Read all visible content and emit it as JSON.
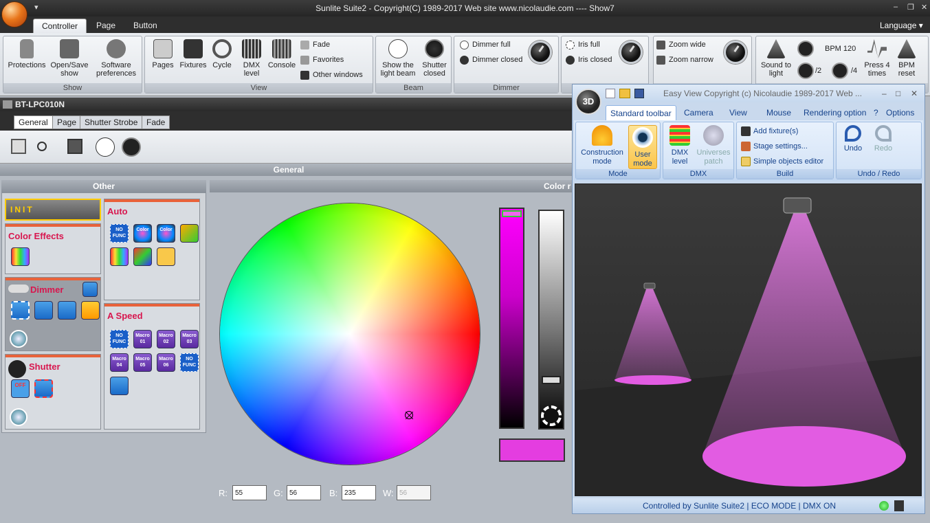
{
  "window": {
    "title": "Sunlite Suite2 - Copyright(C) 1989-2017    Web site www.nicolaudie.com ---- Show7",
    "lang_label": "Language"
  },
  "ribbon_tabs": [
    "Controller",
    "Page",
    "Button"
  ],
  "groups": {
    "show": {
      "label": "Show",
      "protections": "Protections",
      "open_save": "Open/Save show",
      "software_prefs": "Software preferences"
    },
    "view": {
      "label": "View",
      "pages": "Pages",
      "fixtures": "Fixtures",
      "cycle": "Cycle",
      "dmx_level": "DMX level",
      "console": "Console",
      "fade": "Fade",
      "favorites": "Favorites",
      "other_windows": "Other windows"
    },
    "beam": {
      "label": "Beam",
      "show_beam": "Show the light beam",
      "shutter_closed": "Shutter closed"
    },
    "dimmer": {
      "label": "Dimmer",
      "full": "Dimmer full",
      "closed": "Dimmer closed"
    },
    "iris": {
      "full": "Iris full",
      "closed": "Iris closed"
    },
    "zoom": {
      "wide": "Zoom wide",
      "narrow": "Zoom narrow"
    },
    "bpm": {
      "sound": "Sound to light",
      "div2": "/2",
      "div4": "/4",
      "bpm": "BPM 120",
      "press4": "Press 4 times",
      "reset": "BPM reset"
    }
  },
  "device": {
    "name": "BT-LPC010N",
    "tabs": [
      "General",
      "Page",
      "Shutter Strobe",
      "Fade"
    ],
    "general": "General"
  },
  "other": {
    "header": "Other",
    "init": "INIT",
    "color_effects": "Color Effects",
    "dimmer": "Dimmer",
    "shutter": "Shutter",
    "auto": "Auto",
    "a_speed": "A Speed",
    "off": "OFF",
    "nofunc": "NO FUNC",
    "color": "Color",
    "macros": [
      "Macro 01",
      "Macro 02",
      "Macro 03",
      "Macro 04",
      "Macro 05",
      "Macro 06"
    ]
  },
  "color": {
    "header": "Color r",
    "r_label": "R:",
    "g_label": "G:",
    "b_label": "B:",
    "w_label": "W:",
    "r": "55",
    "g": "56",
    "b": "235",
    "w": "56",
    "swatch": "#e43de0"
  },
  "easyview": {
    "title": "Easy View   Copyright (c) Nicolaudie 1989-2017   Web ...",
    "logo": "3D",
    "tabs": [
      "Standard toolbar",
      "Camera",
      "View",
      "Mouse",
      "Rendering option",
      "?",
      "Options"
    ],
    "mode": {
      "label": "Mode",
      "construction": "Construction mode",
      "user": "User mode"
    },
    "dmx": {
      "label": "DMX",
      "level": "DMX level",
      "patch": "Universes patch"
    },
    "build": {
      "label": "Build",
      "add": "Add fixture(s)",
      "stage": "Stage settings...",
      "simple": "Simple objects editor"
    },
    "undo": {
      "label": "Undo / Redo",
      "undo": "Undo",
      "redo": "Redo"
    },
    "status": "Controlled by Sunlite Suite2  |  ECO MODE  |  DMX ON"
  }
}
